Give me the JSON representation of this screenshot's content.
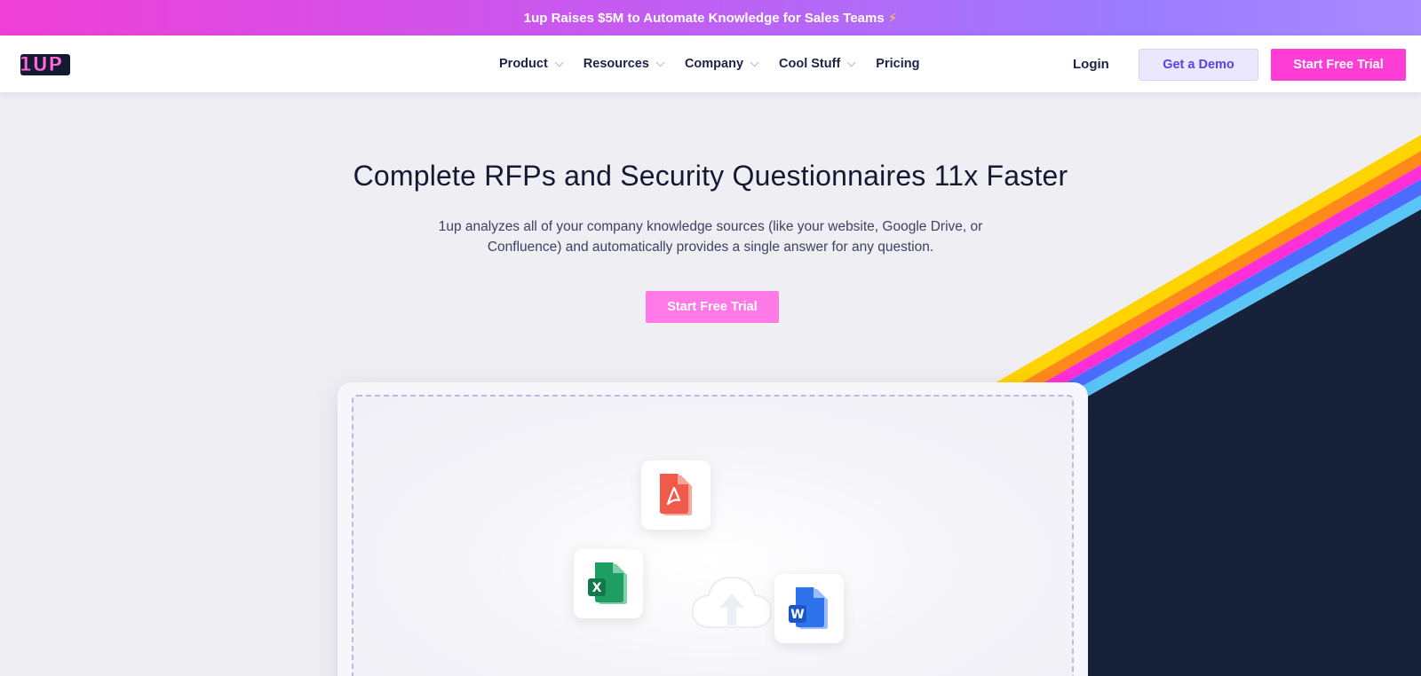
{
  "announcement": {
    "text": "1up Raises $5M to Automate Knowledge for Sales Teams",
    "icon": "lightning-bolt-icon"
  },
  "nav": {
    "logo_text": "1UP",
    "menu": [
      {
        "label": "Product",
        "has_dropdown": true
      },
      {
        "label": "Resources",
        "has_dropdown": true
      },
      {
        "label": "Company",
        "has_dropdown": true
      },
      {
        "label": "Cool Stuff",
        "has_dropdown": true
      },
      {
        "label": "Pricing",
        "has_dropdown": false
      }
    ],
    "login_label": "Login",
    "demo_label": "Get a Demo",
    "trial_label": "Start Free Trial"
  },
  "hero": {
    "title": "Complete RFPs and Security Questionnaires 11x Faster",
    "subtitle_line1": "1up analyzes all of your company knowledge sources (like your website, Google Drive, or",
    "subtitle_line2": "Confluence) and automatically provides a single answer for any question.",
    "cta_label": "Start Free Trial"
  },
  "upload": {
    "icons": [
      "pdf-file-icon",
      "excel-file-icon",
      "word-file-icon",
      "cloud-upload-icon"
    ],
    "pdf_badge": "",
    "excel_badge": "X",
    "word_badge": "W"
  },
  "colors": {
    "brand_pink": "#ff3dd6",
    "demo_purple": "#5443e8",
    "navy": "#17213a",
    "stripe_yellow": "#ffd400",
    "stripe_orange": "#ff8a1a",
    "stripe_magenta": "#ff2fd8",
    "stripe_blue": "#4a6cff",
    "stripe_cyan": "#59c6f7"
  }
}
